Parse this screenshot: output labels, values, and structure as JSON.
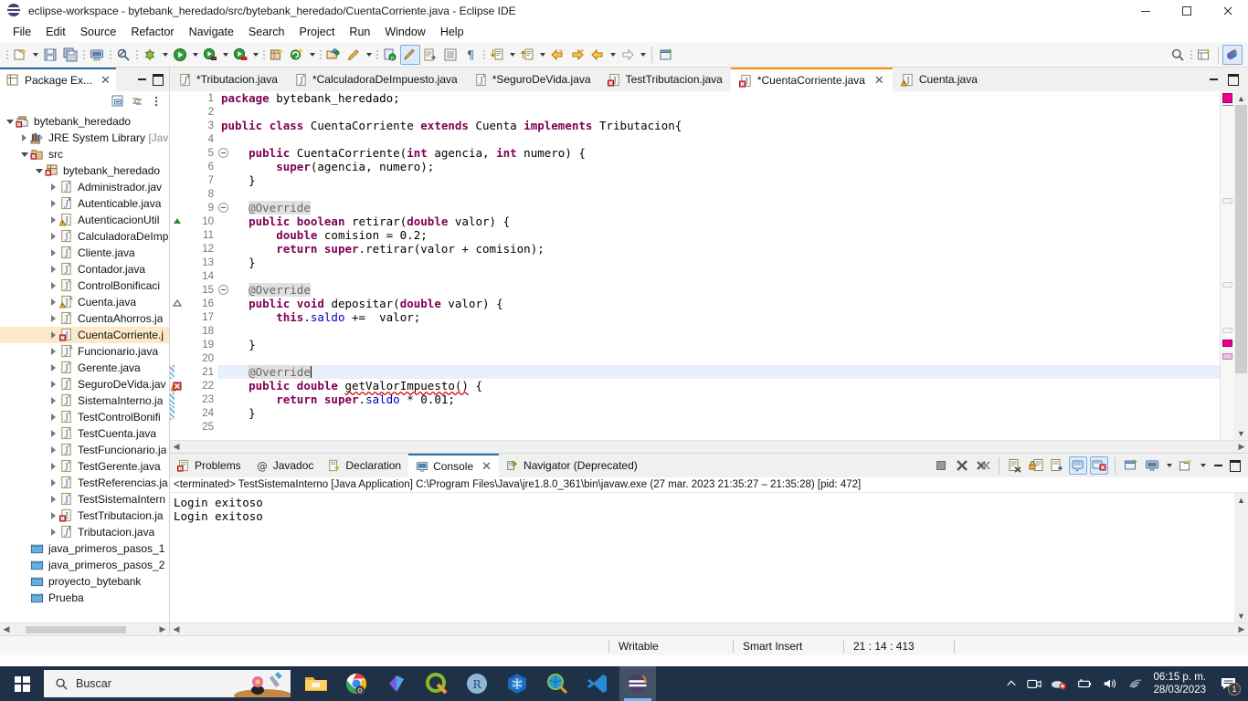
{
  "window": {
    "title": "eclipse-workspace - bytebank_heredado/src/bytebank_heredado/CuentaCorriente.java - Eclipse IDE",
    "minimize": "—",
    "maximize": "□",
    "close": "✕"
  },
  "menubar": {
    "items": [
      "File",
      "Edit",
      "Source",
      "Refactor",
      "Navigate",
      "Search",
      "Project",
      "Run",
      "Window",
      "Help"
    ]
  },
  "explorer": {
    "tab_label": "Package Ex...",
    "close": "✕",
    "tree": [
      {
        "label": "bytebank_heredado",
        "indent": 0,
        "twist": "open",
        "icon": "java-project-icon",
        "selected": false,
        "dim": ""
      },
      {
        "label": "JRE System Library ",
        "indent": 1,
        "twist": "closed",
        "icon": "library-icon",
        "selected": false,
        "dim": "[Java"
      },
      {
        "label": "src",
        "indent": 1,
        "twist": "open",
        "icon": "source-folder-icon",
        "selected": false,
        "dim": ""
      },
      {
        "label": "bytebank_heredado",
        "indent": 2,
        "twist": "open",
        "icon": "package-icon",
        "selected": false,
        "dim": ""
      },
      {
        "label": "Administrador.jav",
        "indent": 3,
        "twist": "closed",
        "icon": "java-file-icon",
        "selected": false,
        "dim": ""
      },
      {
        "label": "Autenticable.java",
        "indent": 3,
        "twist": "closed",
        "icon": "java-interface-icon",
        "selected": false,
        "dim": ""
      },
      {
        "label": "AutenticacionUtil",
        "indent": 3,
        "twist": "closed",
        "icon": "java-file-warning-icon",
        "selected": false,
        "dim": ""
      },
      {
        "label": "CalculadoraDeImp",
        "indent": 3,
        "twist": "closed",
        "icon": "java-file-icon",
        "selected": false,
        "dim": ""
      },
      {
        "label": "Cliente.java",
        "indent": 3,
        "twist": "closed",
        "icon": "java-file-icon",
        "selected": false,
        "dim": ""
      },
      {
        "label": "Contador.java",
        "indent": 3,
        "twist": "closed",
        "icon": "java-file-icon",
        "selected": false,
        "dim": ""
      },
      {
        "label": "ControlBonificaci",
        "indent": 3,
        "twist": "closed",
        "icon": "java-file-icon",
        "selected": false,
        "dim": ""
      },
      {
        "label": "Cuenta.java",
        "indent": 3,
        "twist": "closed",
        "icon": "java-abstract-warning-icon",
        "selected": false,
        "dim": ""
      },
      {
        "label": "CuentaAhorros.ja",
        "indent": 3,
        "twist": "closed",
        "icon": "java-file-icon",
        "selected": false,
        "dim": ""
      },
      {
        "label": "CuentaCorriente.j",
        "indent": 3,
        "twist": "closed",
        "icon": "java-file-error-icon",
        "selected": true,
        "dim": ""
      },
      {
        "label": "Funcionario.java",
        "indent": 3,
        "twist": "closed",
        "icon": "java-abstract-icon",
        "selected": false,
        "dim": ""
      },
      {
        "label": "Gerente.java",
        "indent": 3,
        "twist": "closed",
        "icon": "java-file-icon",
        "selected": false,
        "dim": ""
      },
      {
        "label": "SeguroDeVida.jav",
        "indent": 3,
        "twist": "closed",
        "icon": "java-file-icon",
        "selected": false,
        "dim": ""
      },
      {
        "label": "SistemaInterno.ja",
        "indent": 3,
        "twist": "closed",
        "icon": "java-file-icon",
        "selected": false,
        "dim": ""
      },
      {
        "label": "TestControlBonifi",
        "indent": 3,
        "twist": "closed",
        "icon": "java-file-icon",
        "selected": false,
        "dim": ""
      },
      {
        "label": "TestCuenta.java",
        "indent": 3,
        "twist": "closed",
        "icon": "java-file-icon",
        "selected": false,
        "dim": ""
      },
      {
        "label": "TestFuncionario.ja",
        "indent": 3,
        "twist": "closed",
        "icon": "java-file-icon",
        "selected": false,
        "dim": ""
      },
      {
        "label": "TestGerente.java",
        "indent": 3,
        "twist": "closed",
        "icon": "java-file-icon",
        "selected": false,
        "dim": ""
      },
      {
        "label": "TestReferencias.ja",
        "indent": 3,
        "twist": "closed",
        "icon": "java-file-icon",
        "selected": false,
        "dim": ""
      },
      {
        "label": "TestSistemaIntern",
        "indent": 3,
        "twist": "closed",
        "icon": "java-file-icon",
        "selected": false,
        "dim": ""
      },
      {
        "label": "TestTributacion.ja",
        "indent": 3,
        "twist": "closed",
        "icon": "java-file-error-icon",
        "selected": false,
        "dim": ""
      },
      {
        "label": "Tributacion.java",
        "indent": 3,
        "twist": "closed",
        "icon": "java-interface-icon",
        "selected": false,
        "dim": ""
      },
      {
        "label": "java_primeros_pasos_1",
        "indent": 1,
        "twist": "none",
        "icon": "closed-project-icon",
        "selected": false,
        "dim": ""
      },
      {
        "label": "java_primeros_pasos_2",
        "indent": 1,
        "twist": "none",
        "icon": "closed-project-icon",
        "selected": false,
        "dim": ""
      },
      {
        "label": "proyecto_bytebank",
        "indent": 1,
        "twist": "none",
        "icon": "closed-project-icon",
        "selected": false,
        "dim": ""
      },
      {
        "label": "Prueba",
        "indent": 1,
        "twist": "none",
        "icon": "closed-project-icon",
        "selected": false,
        "dim": ""
      }
    ]
  },
  "editor": {
    "tabs": [
      {
        "label": "*Tributacion.java",
        "icon": "java-interface-icon",
        "active": false,
        "closable": false
      },
      {
        "label": "*CalculadoraDeImpuesto.java",
        "icon": "java-file-icon",
        "active": false,
        "closable": false
      },
      {
        "label": "*SeguroDeVida.java",
        "icon": "java-file-icon",
        "active": false,
        "closable": false
      },
      {
        "label": "TestTributacion.java",
        "icon": "java-file-error-icon",
        "active": false,
        "closable": false
      },
      {
        "label": "*CuentaCorriente.java",
        "icon": "java-file-error-icon",
        "active": true,
        "closable": true
      },
      {
        "label": "Cuenta.java",
        "icon": "java-warning-icon",
        "active": false,
        "closable": false
      }
    ],
    "close_glyph": "✕",
    "lines": [
      {
        "n": 1,
        "fold": false,
        "marker": "",
        "hl": false,
        "tokens": [
          {
            "t": "package ",
            "c": "kw"
          },
          {
            "t": "bytebank_heredado;",
            "c": ""
          }
        ]
      },
      {
        "n": 2,
        "fold": false,
        "marker": "",
        "hl": false,
        "tokens": []
      },
      {
        "n": 3,
        "fold": false,
        "marker": "",
        "hl": false,
        "tokens": [
          {
            "t": "public ",
            "c": "kw"
          },
          {
            "t": "class ",
            "c": "kw"
          },
          {
            "t": "CuentaCorriente ",
            "c": ""
          },
          {
            "t": "extends ",
            "c": "kw"
          },
          {
            "t": "Cuenta ",
            "c": ""
          },
          {
            "t": "implements ",
            "c": "kw"
          },
          {
            "t": "Tributacion{",
            "c": ""
          }
        ]
      },
      {
        "n": 4,
        "fold": false,
        "marker": "",
        "hl": false,
        "tokens": []
      },
      {
        "n": 5,
        "fold": true,
        "marker": "",
        "hl": false,
        "tokens": [
          {
            "t": "    ",
            "c": ""
          },
          {
            "t": "public ",
            "c": "kw"
          },
          {
            "t": "CuentaCorriente(",
            "c": ""
          },
          {
            "t": "int",
            "c": "kw"
          },
          {
            "t": " agencia, ",
            "c": ""
          },
          {
            "t": "int",
            "c": "kw"
          },
          {
            "t": " numero) {",
            "c": ""
          }
        ]
      },
      {
        "n": 6,
        "fold": false,
        "marker": "",
        "hl": false,
        "tokens": [
          {
            "t": "        ",
            "c": ""
          },
          {
            "t": "super",
            "c": "kw"
          },
          {
            "t": "(agencia, numero);",
            "c": ""
          }
        ]
      },
      {
        "n": 7,
        "fold": false,
        "marker": "",
        "hl": false,
        "tokens": [
          {
            "t": "    }",
            "c": ""
          }
        ]
      },
      {
        "n": 8,
        "fold": false,
        "marker": "",
        "hl": false,
        "tokens": []
      },
      {
        "n": 9,
        "fold": true,
        "marker": "",
        "hl": false,
        "tokens": [
          {
            "t": "    ",
            "c": ""
          },
          {
            "t": "@Override",
            "c": "ann"
          }
        ]
      },
      {
        "n": 10,
        "fold": false,
        "marker": "override-up",
        "hl": false,
        "tokens": [
          {
            "t": "    ",
            "c": ""
          },
          {
            "t": "public ",
            "c": "kw"
          },
          {
            "t": "boolean ",
            "c": "kw"
          },
          {
            "t": "retirar(",
            "c": ""
          },
          {
            "t": "double",
            "c": "kw"
          },
          {
            "t": " valor) {",
            "c": ""
          }
        ]
      },
      {
        "n": 11,
        "fold": false,
        "marker": "",
        "hl": false,
        "tokens": [
          {
            "t": "        ",
            "c": ""
          },
          {
            "t": "double",
            "c": "kw"
          },
          {
            "t": " comision = 0.2;",
            "c": ""
          }
        ]
      },
      {
        "n": 12,
        "fold": false,
        "marker": "",
        "hl": false,
        "tokens": [
          {
            "t": "        ",
            "c": ""
          },
          {
            "t": "return ",
            "c": "kw"
          },
          {
            "t": "super",
            "c": "kw"
          },
          {
            "t": ".retirar(valor + comision);",
            "c": ""
          }
        ]
      },
      {
        "n": 13,
        "fold": false,
        "marker": "",
        "hl": false,
        "tokens": [
          {
            "t": "    }",
            "c": ""
          }
        ]
      },
      {
        "n": 14,
        "fold": false,
        "marker": "",
        "hl": false,
        "tokens": []
      },
      {
        "n": 15,
        "fold": true,
        "marker": "",
        "hl": false,
        "tokens": [
          {
            "t": "    ",
            "c": ""
          },
          {
            "t": "@Override",
            "c": "ann"
          }
        ]
      },
      {
        "n": 16,
        "fold": false,
        "marker": "implement-up",
        "hl": false,
        "tokens": [
          {
            "t": "    ",
            "c": ""
          },
          {
            "t": "public ",
            "c": "kw"
          },
          {
            "t": "void ",
            "c": "kw"
          },
          {
            "t": "depositar(",
            "c": ""
          },
          {
            "t": "double",
            "c": "kw"
          },
          {
            "t": " valor) {",
            "c": ""
          }
        ]
      },
      {
        "n": 17,
        "fold": false,
        "marker": "",
        "hl": false,
        "tokens": [
          {
            "t": "        ",
            "c": ""
          },
          {
            "t": "this",
            "c": "kw"
          },
          {
            "t": ".",
            "c": ""
          },
          {
            "t": "saldo",
            "c": "fld"
          },
          {
            "t": " +=  valor;",
            "c": ""
          }
        ]
      },
      {
        "n": 18,
        "fold": false,
        "marker": "",
        "hl": false,
        "tokens": []
      },
      {
        "n": 19,
        "fold": false,
        "marker": "",
        "hl": false,
        "tokens": [
          {
            "t": "    }",
            "c": ""
          }
        ]
      },
      {
        "n": 20,
        "fold": false,
        "marker": "",
        "hl": false,
        "tokens": []
      },
      {
        "n": 21,
        "fold": true,
        "marker": "changed",
        "hl": true,
        "tokens": [
          {
            "t": "    ",
            "c": ""
          },
          {
            "t": "@Override",
            "c": "ann"
          },
          {
            "t": "|",
            "c": "caret"
          }
        ]
      },
      {
        "n": 22,
        "fold": false,
        "marker": "error",
        "hl": false,
        "tokens": [
          {
            "t": "    ",
            "c": ""
          },
          {
            "t": "public ",
            "c": "kw"
          },
          {
            "t": "double ",
            "c": "kw"
          },
          {
            "t": "getValorImpuesto()",
            "c": "err"
          },
          {
            "t": " {",
            "c": ""
          }
        ]
      },
      {
        "n": 23,
        "fold": false,
        "marker": "changed",
        "hl": false,
        "tokens": [
          {
            "t": "        ",
            "c": ""
          },
          {
            "t": "return ",
            "c": "kw"
          },
          {
            "t": "super",
            "c": "kw"
          },
          {
            "t": ".",
            "c": ""
          },
          {
            "t": "saldo",
            "c": "fld"
          },
          {
            "t": " * 0.01;",
            "c": ""
          }
        ]
      },
      {
        "n": 24,
        "fold": false,
        "marker": "changed",
        "hl": false,
        "tokens": [
          {
            "t": "    }",
            "c": ""
          }
        ]
      },
      {
        "n": 25,
        "fold": false,
        "marker": "",
        "hl": false,
        "tokens": []
      }
    ]
  },
  "bottom": {
    "tabs": [
      {
        "label": "Problems",
        "icon": "problems-icon",
        "active": false,
        "closable": false
      },
      {
        "label": "Javadoc",
        "icon": "javadoc-icon",
        "active": false,
        "closable": false
      },
      {
        "label": "Declaration",
        "icon": "declaration-icon",
        "active": false,
        "closable": false
      },
      {
        "label": "Console",
        "icon": "console-icon",
        "active": true,
        "closable": true
      },
      {
        "label": "Navigator (Deprecated)",
        "icon": "navigator-icon",
        "active": false,
        "closable": false
      }
    ],
    "close_glyph": "✕",
    "console_header": "<terminated> TestSistemaInterno [Java Application] C:\\Program Files\\Java\\jre1.8.0_361\\bin\\javaw.exe  (27 mar. 2023 21:35:27 – 21:35:28) [pid: 472]",
    "console_lines": [
      "Login exitoso",
      "Login exitoso"
    ]
  },
  "statusbar": {
    "writable": "Writable",
    "insert_mode": "Smart Insert",
    "position": "21 : 14 : 413"
  },
  "taskbar": {
    "search_placeholder": "Buscar",
    "apps": [
      {
        "name": "file-explorer-icon"
      },
      {
        "name": "chrome-icon"
      },
      {
        "name": "microsoft-365-icon"
      },
      {
        "name": "qgis-icon"
      },
      {
        "name": "rstudio-icon"
      },
      {
        "name": "globe-app-icon"
      },
      {
        "name": "search-app-icon"
      },
      {
        "name": "vscode-icon"
      },
      {
        "name": "eclipse-icon"
      }
    ],
    "clock_time": "06:15 p. m.",
    "clock_date": "28/03/2023",
    "notification_count": "1"
  },
  "colors": {
    "accent": "#2b6ca3",
    "editor_tab_active": "#ff8c00",
    "keyword": "#7f0055",
    "field": "#0000c0",
    "selection": "#fde9c8",
    "taskbar": "#1f3147"
  }
}
